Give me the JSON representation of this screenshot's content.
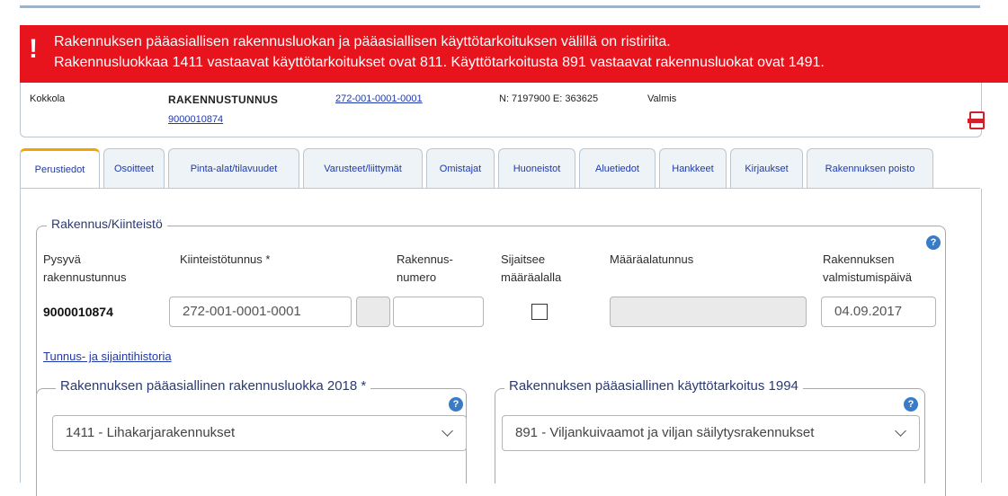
{
  "alert": {
    "line1": "Rakennuksen pääasiallisen rakennusluokan ja pääasiallisen käyttötarkoituksen välillä on ristiriita.",
    "line2": "Rakennusluokkaa 1411 vastaavat käyttötarkoitukset ovat 811. Käyttötarkoitusta 891 vastaavat rakennusluokat ovat 1491."
  },
  "header": {
    "municipality": "Kokkola",
    "building_id_label": "RAKENNUSTUNNUS",
    "building_id": "272-001-0001-0001",
    "building_number": "9000010874",
    "coordinates": "N: 7197900 E: 363625",
    "status": "Valmis"
  },
  "tabs": [
    {
      "label": "Perustiedot"
    },
    {
      "label": "Osoitteet"
    },
    {
      "label": "Pinta-alat/tilavuudet"
    },
    {
      "label": "Varusteet/liittymät"
    },
    {
      "label": "Omistajat"
    },
    {
      "label": "Huoneistot"
    },
    {
      "label": "Aluetiedot"
    },
    {
      "label": "Hankkeet"
    },
    {
      "label": "Kirjaukset"
    },
    {
      "label": "Rakennuksen poisto"
    }
  ],
  "section": {
    "title": "Rakennus/Kiinteistö",
    "labels": {
      "pysyva_1": "Pysyvä",
      "pysyva_2": "rakennustunnus",
      "kiinteisto": "Kiinteistötunnus *",
      "rak_num_1": "Rakennus-",
      "rak_num_2": "numero",
      "sijaitsee_1": "Sijaitsee",
      "sijaitsee_2": "määräalalla",
      "maaraala": "Määräalatunnus",
      "valm_1": "Rakennuksen",
      "valm_2": "valmistumispäivä"
    },
    "values": {
      "pysyva": "9000010874",
      "kiinteisto": "272-001-0001-0001",
      "valmistumispaiva": "04.09.2017"
    },
    "history_link": "Tunnus- ja sijaintihistoria"
  },
  "class_section": {
    "legend": "Rakennuksen pääasiallinen rakennusluokka 2018 *",
    "selected": "1411 - Lihakarjarakennukset"
  },
  "usage_section": {
    "legend": "Rakennuksen pääasiallinen käyttötarkoitus 1994",
    "selected": "891 - Viljankuivaamot ja viljan säilytysrakennukset"
  },
  "icons": {
    "help": "?",
    "alert": "!"
  },
  "colors": {
    "alert_bg": "#e8141d",
    "link": "#1f3aa8",
    "active_tab": "#f0a500",
    "help": "#3a7bc8"
  }
}
